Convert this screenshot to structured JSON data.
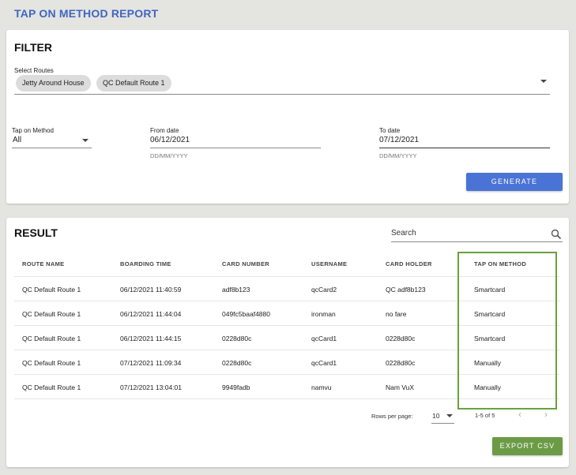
{
  "page": {
    "title": "TAP ON METHOD REPORT"
  },
  "filter": {
    "title": "FILTER",
    "routes_label": "Select Routes",
    "selected_routes": [
      "Jetty Around House",
      "QC Default Route 1"
    ],
    "method_label": "Tap on Method",
    "method_value": "All",
    "from_label": "From date",
    "from_value": "06/12/2021",
    "from_hint": "DD/MM/YYYY",
    "to_label": "To date",
    "to_value": "07/12/2021",
    "to_hint": "DD/MM/YYYY",
    "generate_label": "GENERATE"
  },
  "result": {
    "title": "RESULT",
    "search_placeholder": "Search",
    "columns": [
      "ROUTE NAME",
      "BOARDING TIME",
      "CARD NUMBER",
      "USERNAME",
      "CARD HOLDER",
      "TAP ON METHOD"
    ],
    "rows": [
      [
        "QC Default Route 1",
        "06/12/2021 11:40:59",
        "adf8b123",
        "qcCard2",
        "QC adf8b123",
        "Smartcard"
      ],
      [
        "QC Default Route 1",
        "06/12/2021 11:44:04",
        "049fc5baaf4880",
        "ironman",
        "no fare",
        "Smartcard"
      ],
      [
        "QC Default Route 1",
        "06/12/2021 11:44:15",
        "0228d80c",
        "qcCard1",
        "0228d80c",
        "Smartcard"
      ],
      [
        "QC Default Route 1",
        "07/12/2021 11:09:34",
        "0228d80c",
        "qcCard1",
        "0228d80c",
        "Manually"
      ],
      [
        "QC Default Route 1",
        "07/12/2021 13:04:01",
        "9949fadb",
        "namvu",
        "Nam VuX",
        "Manually"
      ]
    ],
    "pagination": {
      "rows_per_page_label": "Rows per page:",
      "rows_per_page_value": "10",
      "range_text": "1-5 of 5"
    },
    "export_label": "EXPORT CSV"
  },
  "icons": {
    "search": "search-icon",
    "dropdown": "chevron-down-icon",
    "prev": "chevron-left-icon",
    "next": "chevron-right-icon"
  },
  "colors": {
    "title": "#3f66c0",
    "generate_button": "#4a73d6",
    "export_button": "#6c9b46",
    "highlight_border": "#6aa13c"
  }
}
